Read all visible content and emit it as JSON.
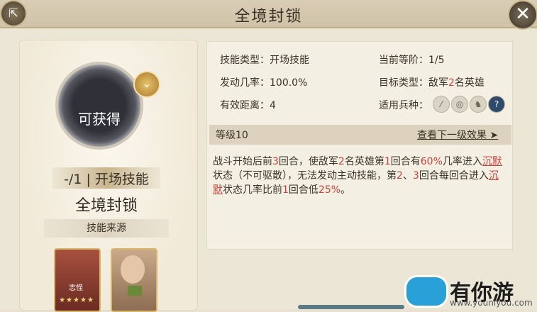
{
  "header": {
    "title": "全境封锁"
  },
  "left": {
    "status": "可获得",
    "level_type": "-/1 | 开场技能",
    "skill_name": "全境封锁",
    "source_label": "技能来源",
    "hero1_tag": "志怪",
    "hero1_stars": "★★★★★"
  },
  "details": {
    "skill_type": "技能类型：开场技能",
    "current_level": "当前等阶：1/5",
    "trigger_rate": "发动几率：100.0%",
    "target_type_prefix": "目标类型：敌军",
    "target_type_num": "2",
    "target_type_suffix": "名英雄",
    "range": "有效距离：4",
    "troop_label": "适用兵种："
  },
  "level": {
    "label": "等级10",
    "next_link": "查看下一级效果 ➤"
  },
  "description": {
    "p1": "战斗开始后前",
    "n1": "3",
    "p2": "回合，使敌军",
    "n2": "2",
    "p3": "名英雄第",
    "n3": "1",
    "p4": "回合有",
    "n4": "60%",
    "p5": "几率进入",
    "s1": "沉默",
    "p6": "状态（不可驱散），无法发动主动技能，第",
    "n5": "2",
    "p7": "、",
    "n6": "3",
    "p8": "回合每回合进入",
    "s2": "沉默",
    "p9": "状态几率比前",
    "n7": "1",
    "p10": "回合低",
    "n8": "25%",
    "p11": "。"
  },
  "watermark": {
    "text": "有你游",
    "url": "www.youniyou.com"
  },
  "colors": {
    "highlight": "#c8423a",
    "frame": "#ece6d7"
  }
}
